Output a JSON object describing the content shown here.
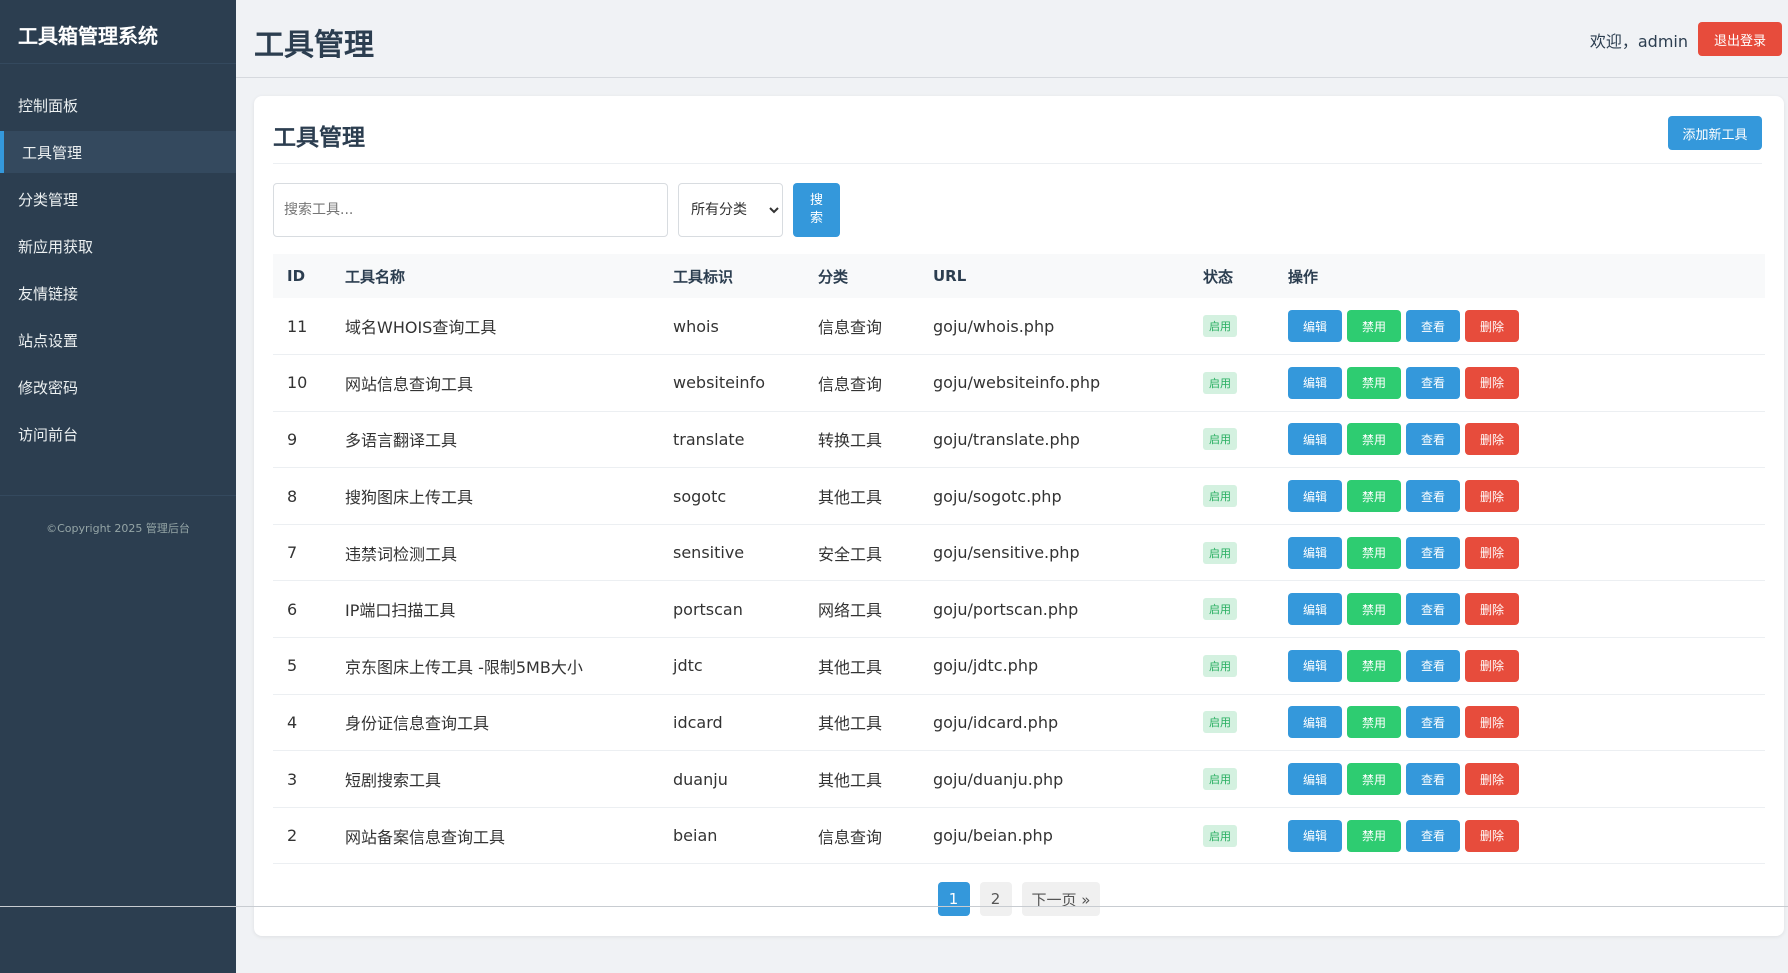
{
  "app": {
    "brand": "工具箱管理系统",
    "copyright": "©Copyright 2025 管理后台"
  },
  "sidebar": {
    "items": [
      {
        "label": "控制面板",
        "active": false
      },
      {
        "label": "工具管理",
        "active": true
      },
      {
        "label": "分类管理",
        "active": false
      },
      {
        "label": "新应用获取",
        "active": false
      },
      {
        "label": "友情链接",
        "active": false
      },
      {
        "label": "站点设置",
        "active": false
      },
      {
        "label": "修改密码",
        "active": false
      },
      {
        "label": "访问前台",
        "active": false
      }
    ]
  },
  "header": {
    "title": "工具管理",
    "welcome": "欢迎，admin",
    "logout_label": "退出登录"
  },
  "card": {
    "title": "工具管理",
    "add_label": "添加新工具",
    "search_placeholder": "搜索工具...",
    "category_selected": "所有分类",
    "search_button": "搜索"
  },
  "table": {
    "headers": [
      "ID",
      "工具名称",
      "工具标识",
      "分类",
      "URL",
      "状态",
      "操作"
    ],
    "rows": [
      {
        "id": "11",
        "name": "域名WHOIS查询工具",
        "key": "whois",
        "category": "信息查询",
        "url": "goju/whois.php",
        "status": "启用"
      },
      {
        "id": "10",
        "name": "网站信息查询工具",
        "key": "websiteinfo",
        "category": "信息查询",
        "url": "goju/websiteinfo.php",
        "status": "启用"
      },
      {
        "id": "9",
        "name": "多语言翻译工具",
        "key": "translate",
        "category": "转换工具",
        "url": "goju/translate.php",
        "status": "启用"
      },
      {
        "id": "8",
        "name": "搜狗图床上传工具",
        "key": "sogotc",
        "category": "其他工具",
        "url": "goju/sogotc.php",
        "status": "启用"
      },
      {
        "id": "7",
        "name": "违禁词检测工具",
        "key": "sensitive",
        "category": "安全工具",
        "url": "goju/sensitive.php",
        "status": "启用"
      },
      {
        "id": "6",
        "name": "IP端口扫描工具",
        "key": "portscan",
        "category": "网络工具",
        "url": "goju/portscan.php",
        "status": "启用"
      },
      {
        "id": "5",
        "name": "京东图床上传工具 -限制5MB大小",
        "key": "jdtc",
        "category": "其他工具",
        "url": "goju/jdtc.php",
        "status": "启用"
      },
      {
        "id": "4",
        "name": "身份证信息查询工具",
        "key": "idcard",
        "category": "其他工具",
        "url": "goju/idcard.php",
        "status": "启用"
      },
      {
        "id": "3",
        "name": "短剧搜索工具",
        "key": "duanju",
        "category": "其他工具",
        "url": "goju/duanju.php",
        "status": "启用"
      },
      {
        "id": "2",
        "name": "网站备案信息查询工具",
        "key": "beian",
        "category": "信息查询",
        "url": "goju/beian.php",
        "status": "启用"
      }
    ],
    "actions": {
      "edit": "编辑",
      "disable": "禁用",
      "view": "查看",
      "delete": "删除"
    }
  },
  "pagination": {
    "pages": [
      "1",
      "2"
    ],
    "current": "1",
    "next": "下一页 »"
  },
  "colors": {
    "sidebar_bg": "#2c3e50",
    "primary": "#3498db",
    "success": "#2ecc71",
    "danger": "#e74c3c"
  }
}
